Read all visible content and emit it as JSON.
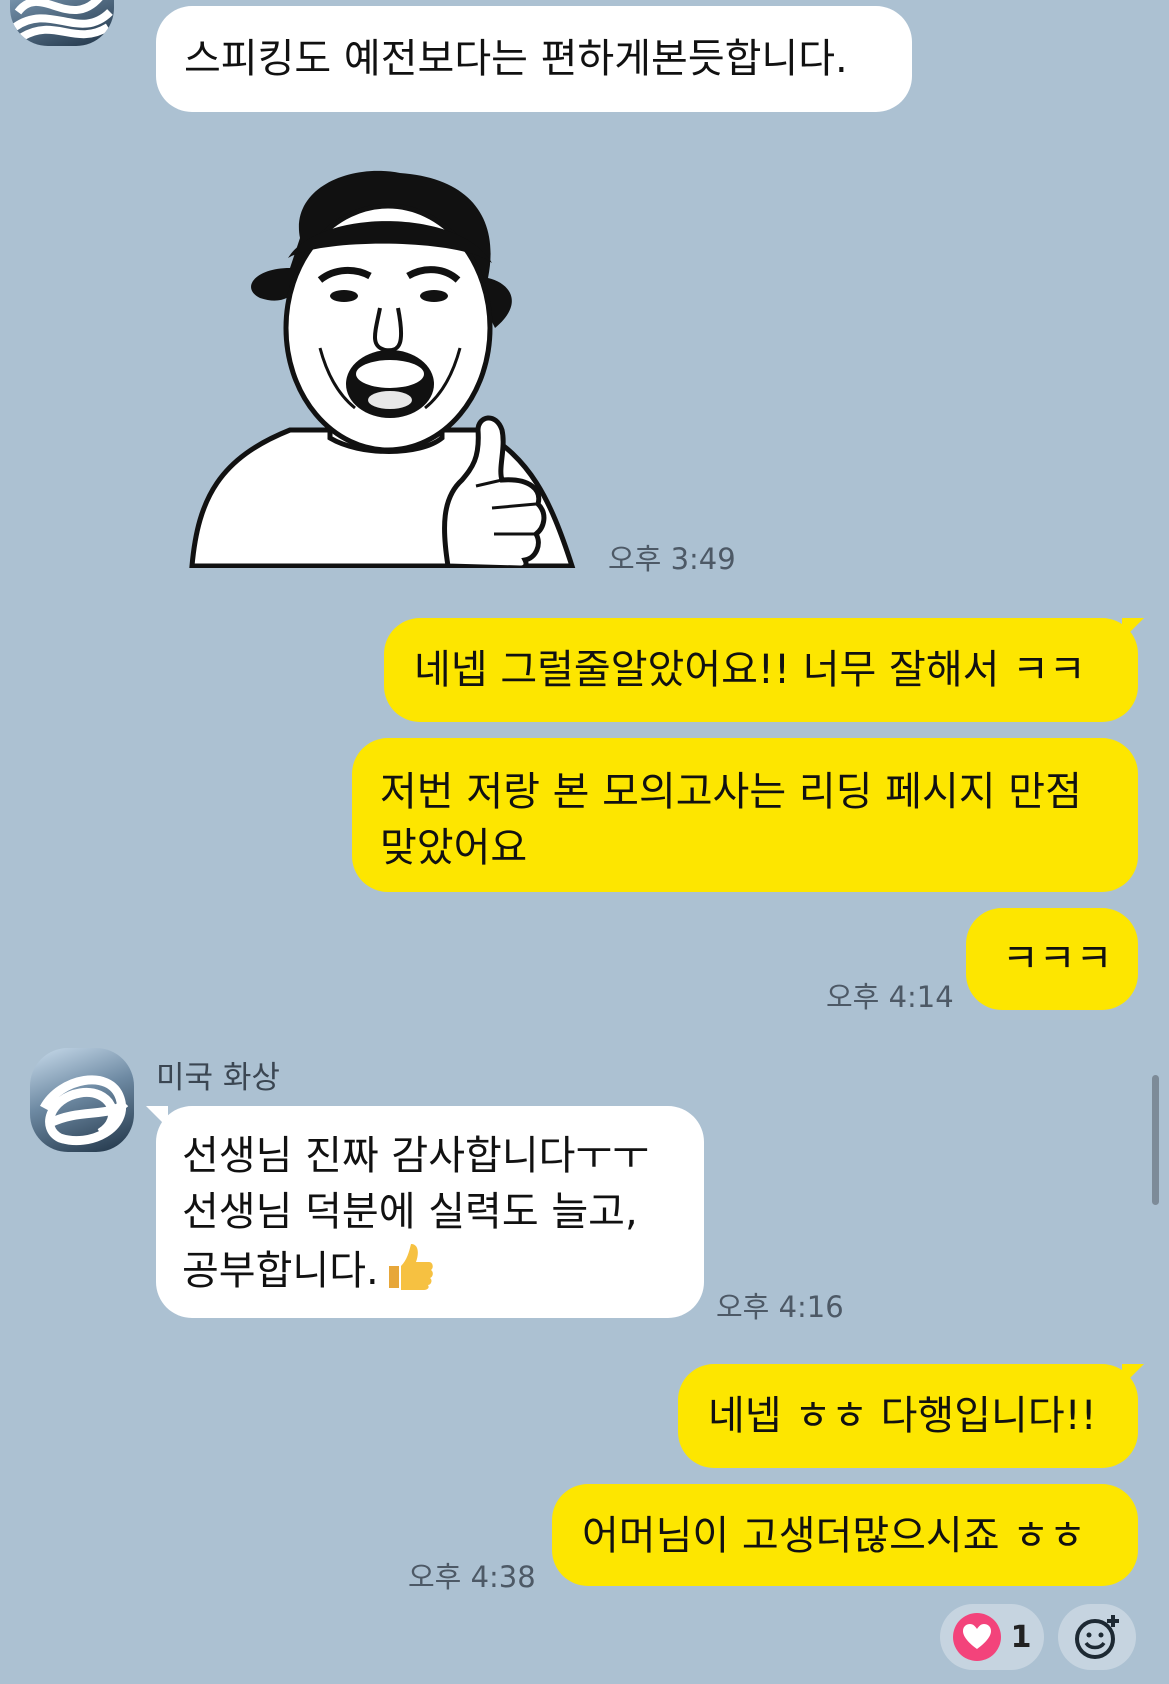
{
  "messages": {
    "m1": "스피킹도 예전보다는 편하게본듯합니다.",
    "sticker_time": "오후 3:49",
    "m2": "네넵 그럴줄알았어요!! 너무 잘해서 ㅋㅋ",
    "m3_line1": "저번 저랑 본 모의고사는 리딩 페시지 만점",
    "m3_line2": "맞았어요",
    "m4": "ㅋㅋㅋ",
    "time_414": "오후 4:14",
    "sender_name": "미국 화상",
    "m5_line1": "선생님 진짜 감사합니다ㅜㅜ",
    "m5_line2": "선생님 덕분에 실력도 늘고,",
    "m5_line3": "공부합니다.",
    "time_416": "오후 4:16",
    "m6": "네넵 ㅎㅎ 다행입니다!!",
    "m7": "어머님이 고생더많으시죠 ㅎㅎ",
    "time_438": "오후 4:38"
  },
  "reaction": {
    "icon": "heart-icon",
    "count": "1"
  },
  "colors": {
    "background": "#acc1d2",
    "incoming": "#ffffff",
    "outgoing": "#fde600",
    "heart": "#f3437b"
  }
}
